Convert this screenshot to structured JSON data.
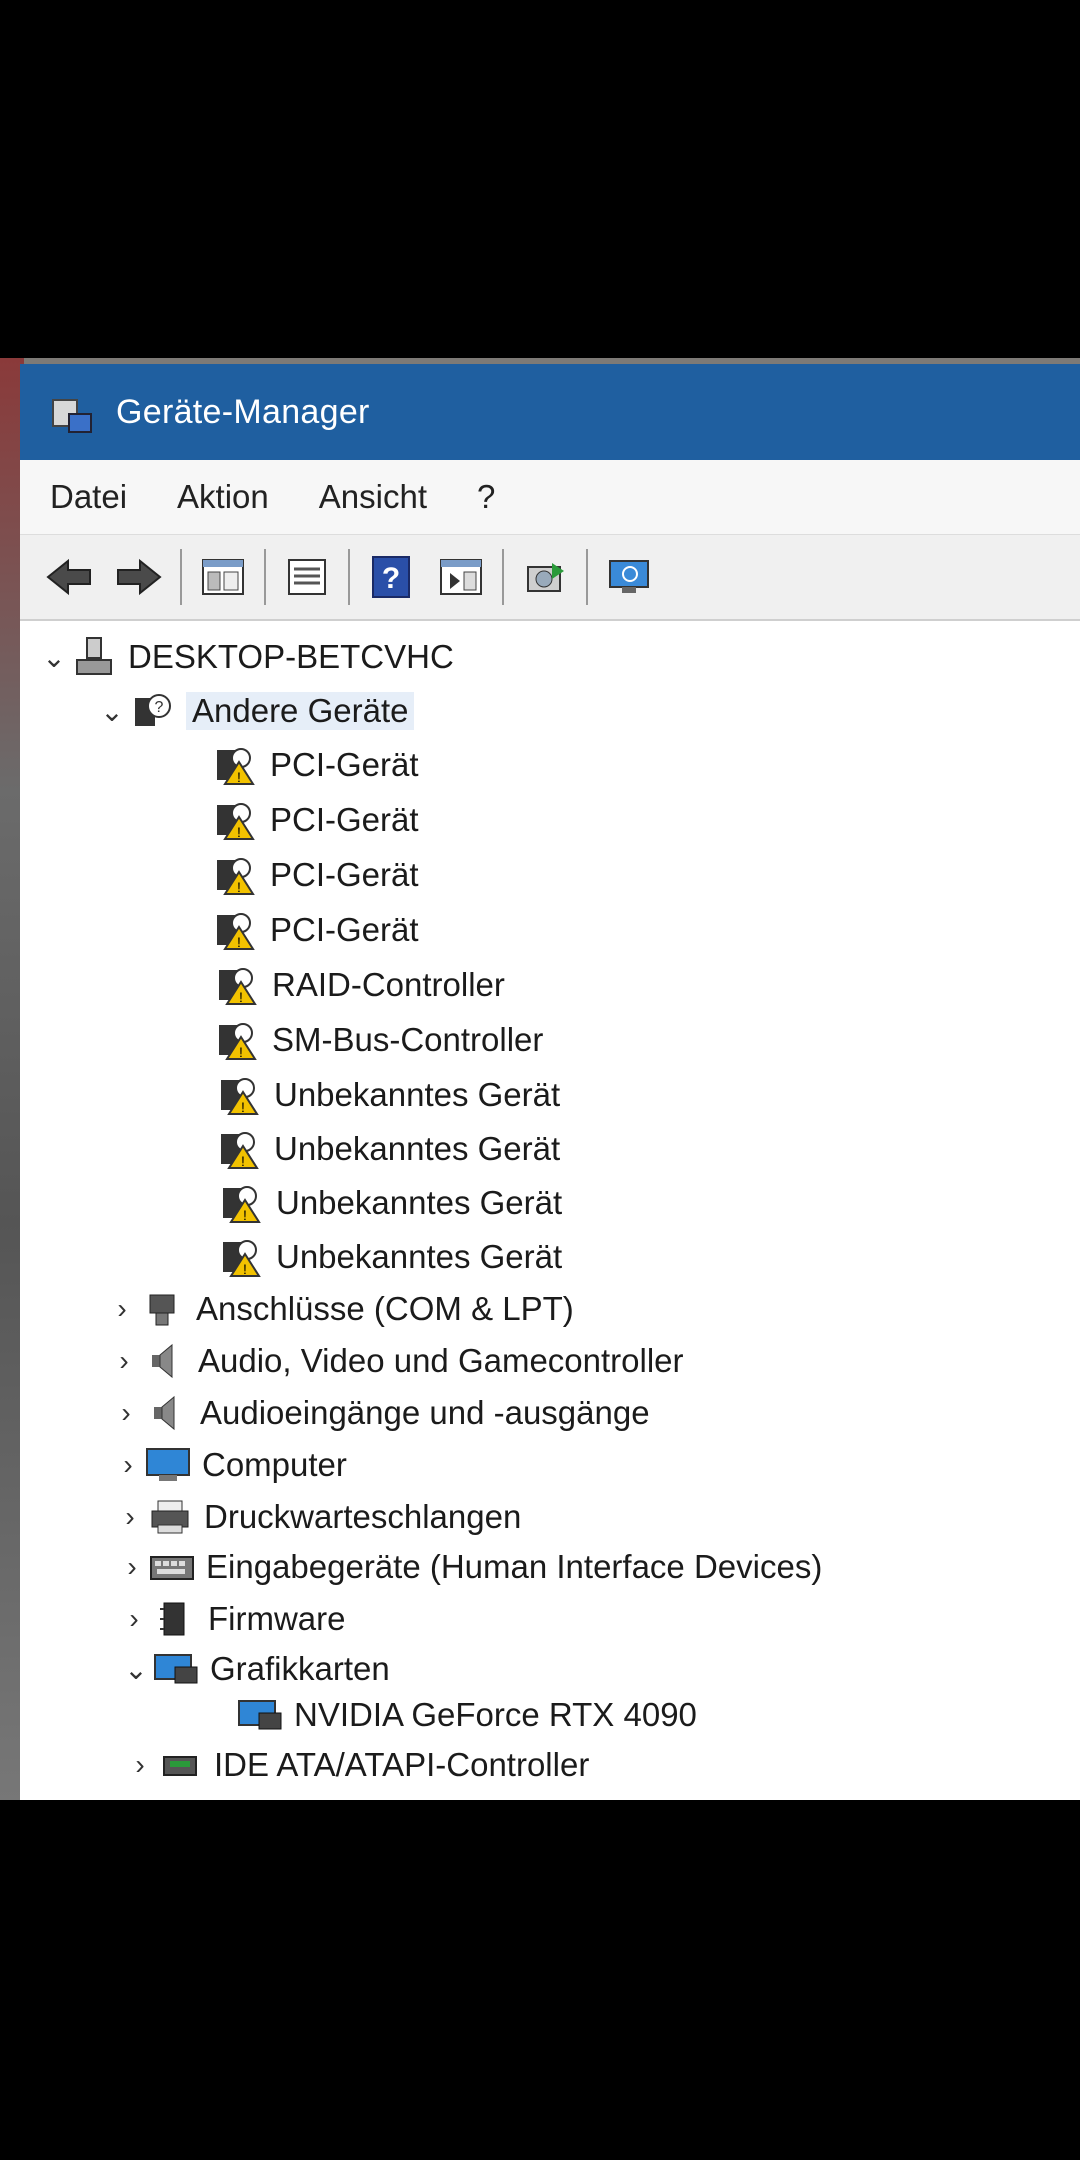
{
  "window": {
    "title": "Geräte-Manager",
    "title_bar_color": "#1f5fa0"
  },
  "menu": [
    "Datei",
    "Aktion",
    "Ansicht",
    "?"
  ],
  "toolbar": {
    "buttons": [
      "back-arrow-icon",
      "forward-arrow-icon",
      "console-tree-icon",
      "properties-icon",
      "help-icon",
      "action-pane-icon",
      "update-driver-icon",
      "scan-hardware-icon"
    ]
  },
  "tree": {
    "root": "DESKTOP-BETCVHC",
    "other_devices": {
      "label": "Andere Geräte",
      "children": [
        "PCI-Gerät",
        "PCI-Gerät",
        "PCI-Gerät",
        "PCI-Gerät",
        "RAID-Controller",
        "SM-Bus-Controller",
        "Unbekanntes Gerät",
        "Unbekanntes Gerät",
        "Unbekanntes Gerät",
        "Unbekanntes Gerät"
      ]
    },
    "categories": [
      {
        "label": "Anschlüsse (COM & LPT)",
        "expanded": false,
        "icon": "port-icon"
      },
      {
        "label": "Audio, Video und Gamecontroller",
        "expanded": false,
        "icon": "speaker-icon"
      },
      {
        "label": "Audioeingänge und -ausgänge",
        "expanded": false,
        "icon": "speaker-icon"
      },
      {
        "label": "Computer",
        "expanded": false,
        "icon": "monitor-icon"
      },
      {
        "label": "Druckwarteschlangen",
        "expanded": false,
        "icon": "printer-icon"
      },
      {
        "label": "Eingabegeräte (Human Interface Devices)",
        "expanded": false,
        "icon": "keyboard-icon"
      },
      {
        "label": "Firmware",
        "expanded": false,
        "icon": "chip-icon"
      },
      {
        "label": "Grafikkarten",
        "expanded": true,
        "icon": "display-adapter-icon"
      },
      {
        "label": "IDE ATA/ATAPI-Controller",
        "expanded": false,
        "icon": "controller-icon"
      }
    ],
    "graphics_child": "NVIDIA GeForce RTX 4090"
  }
}
